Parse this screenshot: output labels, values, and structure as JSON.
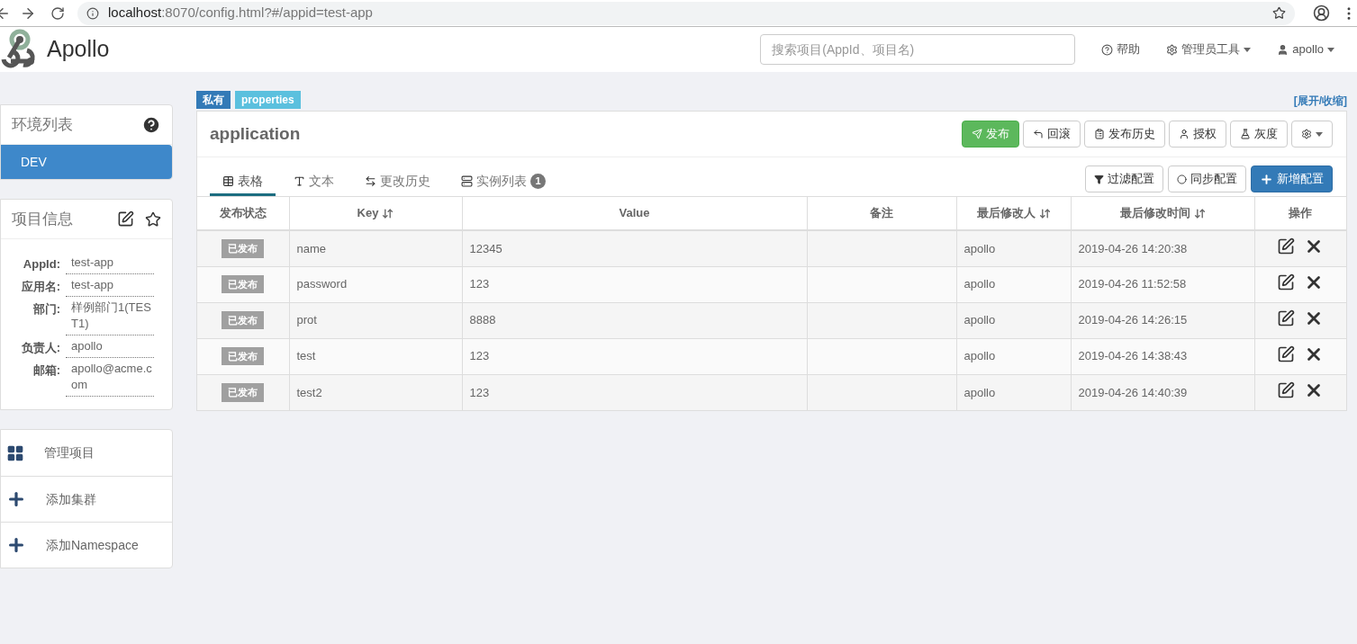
{
  "browser": {
    "url_host": "localhost",
    "url_rest": ":8070/config.html?#/appid=test-app"
  },
  "navbar": {
    "logo_text": "Apollo",
    "search_placeholder": "搜索项目(AppId、项目名)",
    "help": "帮助",
    "admin": "管理员工具",
    "user": "apollo"
  },
  "env_panel": {
    "title": "环境列表",
    "items": [
      {
        "label": "DEV",
        "selected": true
      }
    ]
  },
  "project_panel": {
    "title": "项目信息",
    "fields": [
      {
        "label": "AppId:",
        "value": "test-app"
      },
      {
        "label": "应用名:",
        "value": "test-app"
      },
      {
        "label": "部门:",
        "value": "样例部门1(TEST1)"
      },
      {
        "label": "负责人:",
        "value": "apollo"
      },
      {
        "label": "邮箱:",
        "value": "apollo@acme.com"
      }
    ]
  },
  "actions": [
    {
      "label": "管理项目",
      "kind": "manage"
    },
    {
      "label": "添加集群",
      "kind": "add"
    },
    {
      "label": "添加Namespace",
      "kind": "add"
    }
  ],
  "namespace": {
    "badges": [
      {
        "label": "私有",
        "kind": "private"
      },
      {
        "label": "properties",
        "kind": "format"
      }
    ],
    "toggle": "[展开/收缩]",
    "title": "application",
    "buttons": [
      {
        "label": "发布",
        "kind": "publish"
      },
      {
        "label": "回滚",
        "kind": "rollback"
      },
      {
        "label": "发布历史",
        "kind": "history"
      },
      {
        "label": "授权",
        "kind": "auth"
      },
      {
        "label": "灰度",
        "kind": "gray"
      },
      {
        "kind": "settings"
      }
    ],
    "tabs": [
      {
        "label": "表格",
        "kind": "table",
        "selected": true
      },
      {
        "label": "文本",
        "kind": "text",
        "selected": false
      },
      {
        "label": "更改历史",
        "kind": "changes",
        "selected": false
      },
      {
        "label": "实例列表",
        "kind": "instances",
        "selected": false,
        "badge": "1"
      }
    ],
    "tools": [
      {
        "label": "过滤配置",
        "kind": "filter"
      },
      {
        "label": "同步配置",
        "kind": "sync"
      },
      {
        "label": "新增配置",
        "kind": "add"
      }
    ],
    "table": {
      "columns": [
        {
          "label": "发布状态",
          "sortable": false
        },
        {
          "label": "Key",
          "sortable": true
        },
        {
          "label": "Value",
          "sortable": false
        },
        {
          "label": "备注",
          "sortable": false
        },
        {
          "label": "最后修改人",
          "sortable": true
        },
        {
          "label": "最后修改时间",
          "sortable": true
        },
        {
          "label": "操作",
          "sortable": false
        }
      ],
      "rows": [
        {
          "status": "已发布",
          "key": "name",
          "value": "12345",
          "modifier": "apollo",
          "time": "2019-04-26 14:20:38"
        },
        {
          "status": "已发布",
          "key": "password",
          "value": "123",
          "modifier": "apollo",
          "time": "2019-04-26 11:52:58"
        },
        {
          "status": "已发布",
          "key": "prot",
          "value": "8888",
          "modifier": "apollo",
          "time": "2019-04-26 14:26:15"
        },
        {
          "status": "已发布",
          "key": "test",
          "value": "123",
          "modifier": "apollo",
          "time": "2019-04-26 14:38:43"
        },
        {
          "status": "已发布",
          "key": "test2",
          "value": "123",
          "modifier": "apollo",
          "time": "2019-04-26 14:40:39"
        }
      ]
    }
  }
}
